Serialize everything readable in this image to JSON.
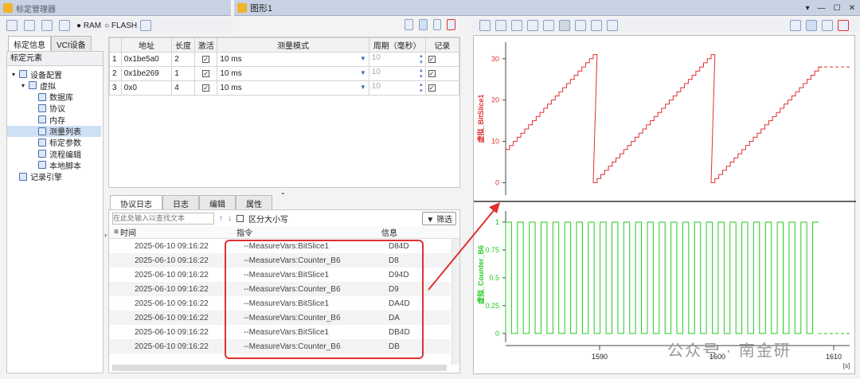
{
  "left_window": {
    "title": "标定管理器",
    "toolbar": {
      "ram_label": "RAM",
      "flash_label": "FLASH"
    },
    "side_tabs": [
      "标定信息",
      "VCI设备"
    ],
    "tree_header": "标定元素",
    "tree": [
      {
        "label": "设备配置",
        "level": 0,
        "expanded": true
      },
      {
        "label": "虚拟",
        "level": 1,
        "expanded": true
      },
      {
        "label": "数据库",
        "level": 2
      },
      {
        "label": "协议",
        "level": 2
      },
      {
        "label": "内存",
        "level": 2
      },
      {
        "label": "测量列表",
        "level": 2,
        "selected": true
      },
      {
        "label": "标定参数",
        "level": 2
      },
      {
        "label": "流程编辑",
        "level": 2
      },
      {
        "label": "本地脚本",
        "level": 2
      },
      {
        "label": "记录引擎",
        "level": 0
      }
    ],
    "measure_table": {
      "headers": [
        "",
        "地址",
        "长度",
        "激活",
        "测量模式",
        "周期（毫秒）",
        "记录"
      ],
      "rows": [
        {
          "idx": "1",
          "addr": "0x1be5a0",
          "len": "2",
          "mode": "10 ms",
          "period": "10"
        },
        {
          "idx": "2",
          "addr": "0x1be269",
          "len": "1",
          "mode": "10 ms",
          "period": "10"
        },
        {
          "idx": "3",
          "addr": "0x0",
          "len": "4",
          "mode": "10 ms",
          "period": "10"
        }
      ]
    },
    "bottom_tabs": [
      "协议日志",
      "日志",
      "编辑",
      "属性"
    ],
    "search": {
      "placeholder": "在此处输入以查找文本",
      "case_label": "区分大小写",
      "filter_label": "筛选"
    },
    "log_headers": [
      "时间",
      "指令",
      "信息"
    ],
    "log_rows": [
      {
        "time": "2025-06-10 09:16:22",
        "cmd": "--MeasureVars:BitSlice1",
        "info": "D84D"
      },
      {
        "time": "2025-06-10 09:16:22",
        "cmd": "--MeasureVars:Counter_B6",
        "info": "D8"
      },
      {
        "time": "2025-06-10 09:16:22",
        "cmd": "--MeasureVars:BitSlice1",
        "info": "D94D"
      },
      {
        "time": "2025-06-10 09:16:22",
        "cmd": "--MeasureVars:Counter_B6",
        "info": "D9"
      },
      {
        "time": "2025-06-10 09:16:22",
        "cmd": "--MeasureVars:BitSlice1",
        "info": "DA4D"
      },
      {
        "time": "2025-06-10 09:16:22",
        "cmd": "--MeasureVars:Counter_B6",
        "info": "DA"
      },
      {
        "time": "2025-06-10 09:16:22",
        "cmd": "--MeasureVars:BitSlice1",
        "info": "DB4D"
      },
      {
        "time": "2025-06-10 09:16:22",
        "cmd": "--MeasureVars:Counter_B6",
        "info": "DB"
      }
    ]
  },
  "right_window": {
    "title": "图形1",
    "window_controls": [
      "▾",
      "—",
      "☐",
      "✕"
    ]
  },
  "chart_data": [
    {
      "type": "line",
      "ylabel": "虚拟_BitSlice1",
      "ylim": [
        -3,
        34
      ],
      "yticks": [
        0,
        10,
        20,
        30
      ],
      "color": "#e03030",
      "series": [
        {
          "values_desc": "staircase 8→31, drop to 0, ramp to 31, drop to 0, ramp to 28, dashed after"
        }
      ]
    },
    {
      "type": "line",
      "ylabel": "虚拟_Counter_B6",
      "ylim": [
        -0.08,
        1.1
      ],
      "yticks": [
        "0",
        "0.25",
        "0.5",
        "0.75",
        "1"
      ],
      "xticks": [
        "1590",
        "1600",
        "1610"
      ],
      "xunit": "[s]",
      "color": "#22cc22"
    }
  ],
  "watermark": "公众号 · 南金研",
  "accent": "#e03030"
}
